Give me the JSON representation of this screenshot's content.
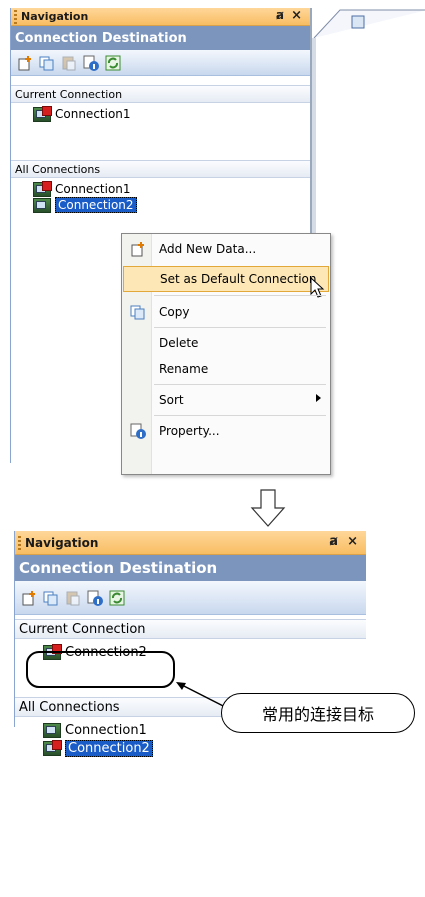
{
  "top_panel": {
    "title": "Navigation",
    "pin": "ⱥ",
    "close": "×",
    "subtitle": "Connection Destination",
    "current_section": "Current Connection",
    "current_items": [
      "Connection1"
    ],
    "all_section": "All Connections",
    "all_items": [
      "Connection1",
      "Connection2"
    ]
  },
  "context_menu": {
    "items": [
      {
        "label": "Add New Data...",
        "icon": "add-data-icon"
      },
      {
        "label": "Set as Default Connection",
        "icon": ""
      },
      {
        "label": "Copy",
        "icon": "copy-icon"
      },
      {
        "label": "Delete",
        "icon": ""
      },
      {
        "label": "Rename",
        "icon": ""
      },
      {
        "label": "Sort",
        "icon": ""
      },
      {
        "label": "Property...",
        "icon": "property-icon"
      }
    ]
  },
  "bottom_panel": {
    "title": "Navigation",
    "pin": "ⱥ",
    "close": "×",
    "subtitle": "Connection Destination",
    "current_section": "Current Connection",
    "current_items": [
      "Connection2"
    ],
    "all_section": "All Connections",
    "all_items": [
      "Connection1",
      "Connection2"
    ]
  },
  "callout": {
    "text": "常用的连接目标"
  },
  "colors": {
    "title_bar": "#f8bd62",
    "subtitle_bar": "#7c95bd",
    "selection": "#1a5cc7",
    "menu_highlight": "#fde7b6"
  }
}
